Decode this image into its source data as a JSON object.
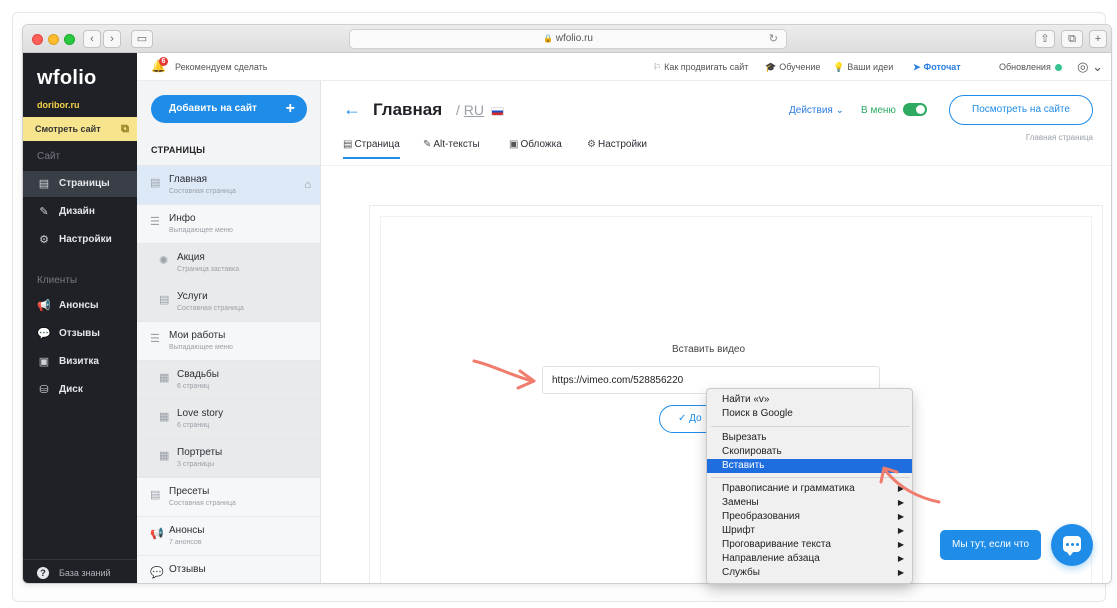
{
  "browser": {
    "url": "wfolio.ru",
    "lock": "🔒",
    "reload": "↻",
    "nav_back": "‹",
    "nav_forward": "›",
    "share": "⇧",
    "tabs": "⧉",
    "newtab": "+"
  },
  "sidebar": {
    "logo": "wfolio",
    "domain": "doribor.ru",
    "view_site": "Смотреть сайт",
    "section_site": "Сайт",
    "section_clients": "Клиенты",
    "items": [
      {
        "label": "Страницы",
        "icon": "page-icon"
      },
      {
        "label": "Дизайн",
        "icon": "brush-icon"
      },
      {
        "label": "Настройки",
        "icon": "gear-icon"
      },
      {
        "label": "Анонсы",
        "icon": "megaphone-icon"
      },
      {
        "label": "Отзывы",
        "icon": "chat-icon"
      },
      {
        "label": "Визитка",
        "icon": "card-icon"
      },
      {
        "label": "Диск",
        "icon": "disk-icon"
      }
    ],
    "knowledge_base": "База знаний"
  },
  "header": {
    "notification_count": "6",
    "recommend": "Рекомендуем сделать",
    "links": {
      "promote": "Как продвигать сайт",
      "learning": "Обучение",
      "ideas": "Ваши идеи",
      "photochat": "Фоточат",
      "updates": "Обновления"
    }
  },
  "pages_panel": {
    "add_button": "Добавить на сайт",
    "title": "СТРАНИЦЫ",
    "items": [
      {
        "name": "Главная",
        "sub": "Составная страница"
      },
      {
        "name": "Инфо",
        "sub": "Выпадающее меню"
      },
      {
        "name": "Акция",
        "sub": "Страница заставка"
      },
      {
        "name": "Услуги",
        "sub": "Составная страница"
      },
      {
        "name": "Мои работы",
        "sub": "Выпадающее меню"
      },
      {
        "name": "Свадьбы",
        "sub": "6 страниц"
      },
      {
        "name": "Love story",
        "sub": "6 страниц"
      },
      {
        "name": "Портреты",
        "sub": "3 страницы"
      },
      {
        "name": "Пресеты",
        "sub": "Составная страница"
      },
      {
        "name": "Анонсы",
        "sub": "7 анонсов"
      },
      {
        "name": "Отзывы",
        "sub": ""
      }
    ]
  },
  "main": {
    "title": "Главная",
    "lang_separator": "/",
    "lang": "RU",
    "actions": "Действия",
    "in_menu": "В меню",
    "view_site": "Посмотреть на сайте",
    "home_page_label": "Главная страница",
    "tabs": [
      "Страница",
      "Alt-тексты",
      "Обложка",
      "Настройки"
    ],
    "insert_video_label": "Вставить видео",
    "video_url": "https://vimeo.com/528856220",
    "add_button_partial": "До"
  },
  "context_menu": {
    "items": [
      "Найти «v»",
      "Поиск в Google",
      "Вырезать",
      "Скопировать",
      "Вставить",
      "Правописание и грамматика",
      "Замены",
      "Преобразования",
      "Шрифт",
      "Проговаривание текста",
      "Направление абзаца",
      "Службы"
    ],
    "highlighted_index": 4
  },
  "help": {
    "label": "Мы тут, если что"
  },
  "colors": {
    "accent": "#1f8ce8",
    "sidebar": "#1f2126",
    "highlight": "#1f6ee0",
    "annotation": "#f07c6e"
  }
}
